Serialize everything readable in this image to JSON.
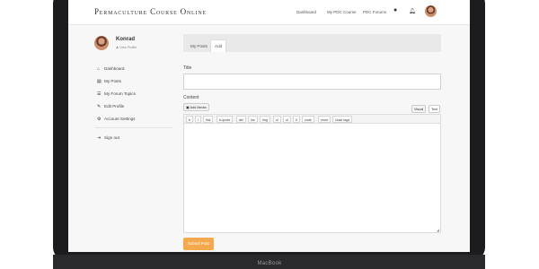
{
  "device": {
    "label": "MacBook"
  },
  "nav": {
    "brand": "Permaculture Course Online",
    "links": [
      "Dashboard",
      "My PDC Course",
      "PDC Forums"
    ]
  },
  "profile": {
    "name": "Konrad",
    "sub_link": "View Profile"
  },
  "sidebar": {
    "items": [
      {
        "icon": "home-icon",
        "glyph": "⌂",
        "label": "Dashboard"
      },
      {
        "icon": "document-icon",
        "glyph": "▤",
        "label": "My Posts"
      },
      {
        "icon": "list-icon",
        "glyph": "☰",
        "label": "My Forum Topics"
      },
      {
        "icon": "pencil-icon",
        "glyph": "✎",
        "label": "Edit Profile"
      },
      {
        "icon": "gear-icon",
        "glyph": "⚙",
        "label": "Account Settings"
      }
    ],
    "signout": {
      "icon": "signout-icon",
      "glyph": "⇥",
      "label": "Sign out"
    }
  },
  "tabs": [
    {
      "label": "My Posts",
      "active": false
    },
    {
      "label": "Add",
      "active": true
    }
  ],
  "form": {
    "title_label": "Title",
    "title_value": "",
    "content_label": "Content",
    "add_media": "Add Media",
    "visual_tab": "Visual",
    "text_tab": "Text",
    "quicktags": [
      "b",
      "i",
      "link",
      "b-quote",
      "del",
      "ins",
      "img",
      "ul",
      "ol",
      "li",
      "code",
      "more",
      "close tags"
    ],
    "submit": "Submit Post"
  },
  "colors": {
    "accent": "#f5a94f",
    "bezel": "#1c1c1e"
  }
}
